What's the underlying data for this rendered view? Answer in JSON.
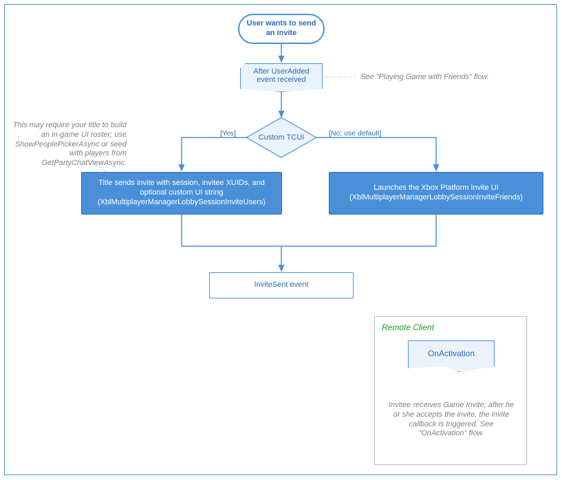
{
  "terminator": {
    "text": "User wants to send an invite"
  },
  "step_useradded": {
    "text": "After UserAdded event received"
  },
  "note_useradded": {
    "text": "See \"Playing Game with Friends\" flow."
  },
  "decision": {
    "label": "Custom TCUI"
  },
  "branch": {
    "yes": "[Yes]",
    "no": "[No; use default]"
  },
  "note_yes": {
    "text": "This may require your title to build an in-game UI roster; use ShowPeoplePickerAsync or seed with players from GetPartyChatViewAsync."
  },
  "process_yes": {
    "text": "Title sends invite with session, invitee XUIDs, and optional custom UI string (XblMultiplayerManagerLobbySessionInviteUsers)"
  },
  "process_no": {
    "text": "Launches the Xbox Platform Invite UI (XblMultiplayerManagerLobbySessionInviteFriends)"
  },
  "invite_sent": {
    "text": "InviteSent event"
  },
  "remote": {
    "title": "Remote Client",
    "onactivation": "OnActivation",
    "note": "Invitee receives Game Invite; after he or she accepts the invite, the invite callback is triggered. See \"OnActivation\" flow."
  },
  "colors": {
    "blue": "#4a90d9",
    "blueText": "#2a6db2",
    "lightBlue": "#eaf2fb",
    "grey": "#808080",
    "green": "#1a9a1a"
  }
}
